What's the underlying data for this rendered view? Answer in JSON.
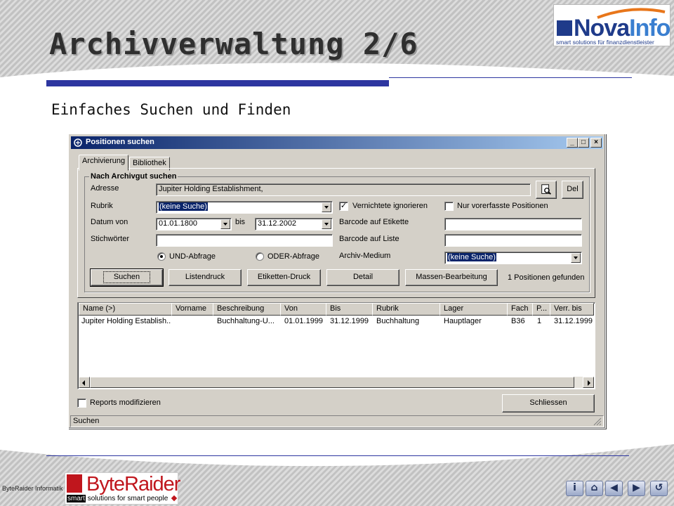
{
  "slide": {
    "title": "Archivverwaltung 2/6",
    "subtitle": "Einfaches Suchen und Finden"
  },
  "logos": {
    "novainfo": {
      "part1": "Nova",
      "part2": "Info",
      "tagline": "smart solutions für finanzdienstleister"
    },
    "byteraider": {
      "caption": "ByteRaider Informatik Gmbh",
      "name": "ByteRaider",
      "tag_smart": "smart",
      "tag_rest": " solutions for smart people"
    }
  },
  "window": {
    "title": "Positionen suchen",
    "minimize": "_",
    "maximize": "□",
    "close": "×",
    "tabs": [
      "Archivierung",
      "Bibliothek"
    ],
    "group_title": "Nach Archivgut suchen",
    "labels": {
      "adresse": "Adresse",
      "rubrik": "Rubrik",
      "datum_von": "Datum von",
      "bis": "bis",
      "stichwoerter": "Stichwörter",
      "barcode_etikette": "Barcode auf Etikette",
      "barcode_liste": "Barcode auf Liste",
      "archiv_medium": "Archiv-Medium"
    },
    "fields": {
      "adresse": "Jupiter Holding Establishment,",
      "rubrik": "(keine Suche)",
      "datum_von": "01.01.1800",
      "datum_bis": "31.12.2002",
      "stichwoerter": "",
      "barcode_etikette": "",
      "barcode_liste": "",
      "archiv_medium": "(keine Suche)"
    },
    "checks": {
      "vernichtete": {
        "label": "Vernichtete ignorieren",
        "checked": true
      },
      "nur_vorerfasste": {
        "label": "Nur vorerfasste Positionen",
        "checked": false
      },
      "reports": {
        "label": "Reports modifizieren",
        "checked": false
      }
    },
    "radios": {
      "und": {
        "label": "UND-Abfrage",
        "selected": true
      },
      "oder": {
        "label": "ODER-Abfrage",
        "selected": false
      }
    },
    "buttons": {
      "search_address": "",
      "del": "Del",
      "suchen": "Suchen",
      "listendruck": "Listendruck",
      "etiketten": "Etiketten-Druck",
      "detail": "Detail",
      "massen": "Massen-Bearbeitung",
      "schliessen": "Schliessen"
    },
    "result_count": "1 Positionen gefunden",
    "columns": [
      "Name (>)",
      "Vorname",
      "Beschreibung",
      "Von",
      "Bis",
      "Rubrik",
      "Lager",
      "Fach",
      "P...",
      "Verr. bis"
    ],
    "rows": [
      [
        "Jupiter Holding Establish...",
        "",
        "Buchhaltung-U...",
        "01.01.1999",
        "31.12.1999",
        "Buchhaltung",
        "Hauptlager",
        "B36",
        "1",
        "31.12.1999"
      ]
    ],
    "status": "Suchen"
  },
  "nav": [
    "i",
    "⌂",
    "◀",
    "▶",
    "↺"
  ]
}
